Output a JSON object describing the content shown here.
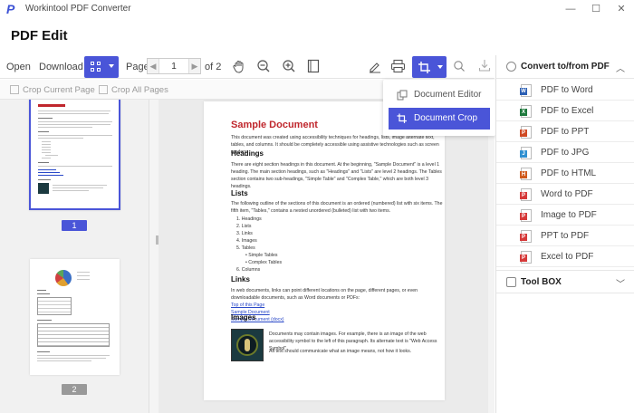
{
  "app": {
    "logo": "P",
    "title": "Workintool PDF Converter"
  },
  "window": {
    "minimize": "—",
    "maximize": "☐",
    "close": "✕"
  },
  "page_heading": "PDF Edit",
  "toolbar": {
    "open": "Open",
    "download": "Download",
    "page_label": "Page",
    "page_value": "1",
    "page_of": "of 2"
  },
  "subbar": {
    "crop_current": "Crop Current Page",
    "crop_all": "Crop All Pages"
  },
  "dropdown": {
    "document_editor": "Document Editor",
    "document_crop": "Document Crop"
  },
  "thumbnails": {
    "page1": "1",
    "page2": "2"
  },
  "document": {
    "title": "Sample Document",
    "intro": "This document was created using accessibility techniques for headings, lists, image alternate text, tables, and columns. It should be completely accessible using assistive technologies such as screen readers.",
    "h_headings": "Headings",
    "p_headings": "There are eight section headings in this document. At the beginning, \"Sample Document\" is a level 1 heading. The main section headings, such as \"Headings\" and \"Lists\" are level 2 headings. The Tables section contains two sub-headings, \"Simple Table\" and \"Complex Table,\" which are both level 3 headings.",
    "h_lists": "Lists",
    "p_lists": "The following outline of the sections of this document is an ordered (numbered) list with six items. The fifth item, \"Tables,\" contains a nested unordered (bulleted) list with two items.",
    "list": [
      "1.   Headings",
      "2.   Lists",
      "3.   Links",
      "4.   Images",
      "5.   Tables",
      "6.   Columns"
    ],
    "sublist": [
      "•  Simple Tables",
      "•  Complex Tables"
    ],
    "h_links": "Links",
    "p_links": "In web documents, links can point different locations on the page, different pages, or even downloadable documents, such as Word documents or PDFs:",
    "links": [
      "Top of this Page",
      "Sample Document",
      "Sample Document (docx)"
    ],
    "h_images": "Images",
    "p_images1": "Documents may contain images. For example, there is an image of the web accessibility symbol to the left of this paragraph. Its alternate text is \"Web Access Symbol\".",
    "p_images2": "Alt text should communicate what an image means, not how it looks."
  },
  "right_panel": {
    "convert_header": "Convert to/from PDF",
    "items": [
      {
        "label": "PDF to Word",
        "badge": "W",
        "color": "#2b5fb4"
      },
      {
        "label": "PDF to Excel",
        "badge": "X",
        "color": "#1f7a3e"
      },
      {
        "label": "PDF to PPT",
        "badge": "P",
        "color": "#d04a24"
      },
      {
        "label": "PDF to JPG",
        "badge": "J",
        "color": "#2f8fd0"
      },
      {
        "label": "PDF to HTML",
        "badge": "H",
        "color": "#d05a1c"
      },
      {
        "label": "Word to PDF",
        "badge": "P",
        "color": "#d63a3a"
      },
      {
        "label": "Image to PDF",
        "badge": "P",
        "color": "#d63a3a"
      },
      {
        "label": "PPT to PDF",
        "badge": "P",
        "color": "#d63a3a"
      },
      {
        "label": "Excel to PDF",
        "badge": "P",
        "color": "#d63a3a"
      }
    ],
    "toolbox_header": "Tool BOX"
  }
}
